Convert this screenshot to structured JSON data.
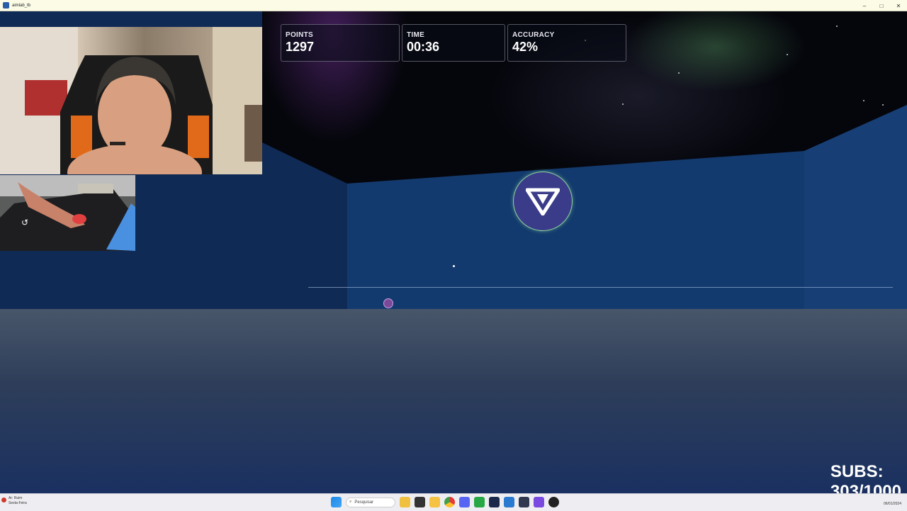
{
  "window": {
    "title": "aimlab_tb",
    "controls": [
      "–",
      "□",
      "✕"
    ]
  },
  "hud": {
    "points": {
      "label": "POINTS",
      "value": "1297"
    },
    "time": {
      "label": "TIME",
      "value": "00:36"
    },
    "accuracy": {
      "label": "ACCURACY",
      "value": "42%",
      "fraction": 0.42
    }
  },
  "overlay": {
    "subs_label": "SUBS:",
    "subs_value": "303/1000"
  },
  "taskbar": {
    "weather_line1": "Ar: Ruim",
    "weather_line2": "Sexta-Feira",
    "search_placeholder": "Pesquisar",
    "date": "06/01/2024",
    "icons": [
      "windows-start-icon",
      "search-icon",
      "crown-icon",
      "task-view-icon",
      "file-explorer-icon",
      "chrome-icon",
      "discord-icon",
      "xbox-icon",
      "aimlab-icon",
      "app-icon",
      "app2-icon",
      "grid-app-icon",
      "game-app-icon"
    ]
  },
  "colors": {
    "wall": "#123566",
    "floor": "#2e3e5a",
    "target_fill": "#3a3c8a",
    "target_ring": "#8fd19a"
  }
}
